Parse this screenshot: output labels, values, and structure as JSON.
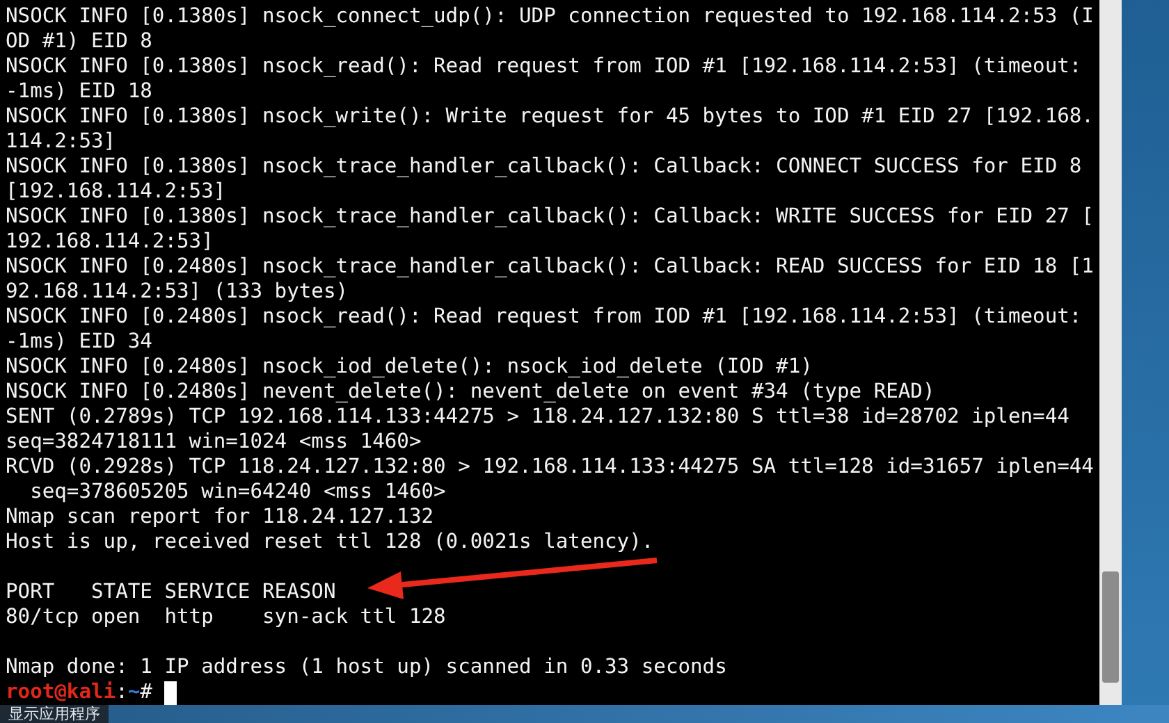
{
  "terminal": {
    "blocks": [
      [
        "NSOCK INFO [0.1380s] nsock_connect_udp(): UDP connection requested to 192.168.114.2:53 (I",
        "OD #1) EID 8",
        "NSOCK INFO [0.1380s] nsock_read(): Read request from IOD #1 [192.168.114.2:53] (timeout:",
        "-1ms) EID 18",
        "NSOCK INFO [0.1380s] nsock_write(): Write request for 45 bytes to IOD #1 EID 27 [192.168.",
        "114.2:53]",
        "NSOCK INFO [0.1380s] nsock_trace_handler_callback(): Callback: CONNECT SUCCESS for EID 8",
        "[192.168.114.2:53]",
        "NSOCK INFO [0.1380s] nsock_trace_handler_callback(): Callback: WRITE SUCCESS for EID 27 [",
        "192.168.114.2:53]",
        "NSOCK INFO [0.2480s] nsock_trace_handler_callback(): Callback: READ SUCCESS for EID 18 [1",
        "92.168.114.2:53] (133 bytes)",
        "NSOCK INFO [0.2480s] nsock_read(): Read request from IOD #1 [192.168.114.2:53] (timeout:",
        "-1ms) EID 34",
        "NSOCK INFO [0.2480s] nsock_iod_delete(): nsock_iod_delete (IOD #1)",
        "NSOCK INFO [0.2480s] nevent_delete(): nevent_delete on event #34 (type READ)",
        "SENT (0.2789s) TCP 192.168.114.133:44275 > 118.24.127.132:80 S ttl=38 id=28702 iplen=44",
        "seq=3824718111 win=1024 <mss 1460>",
        "RCVD (0.2928s) TCP 118.24.127.132:80 > 192.168.114.133:44275 SA ttl=128 id=31657 iplen=44",
        "  seq=378605205 win=64240 <mss 1460>",
        "Nmap scan report for 118.24.127.132",
        "Host is up, received reset ttl 128 (0.0021s latency)."
      ],
      [
        "PORT   STATE SERVICE REASON",
        "80/tcp open  http    syn-ack ttl 128"
      ],
      [
        "Nmap done: 1 IP address (1 host up) scanned in 0.33 seconds"
      ]
    ],
    "prompt": {
      "user_host": "root@kali",
      "separator": ":",
      "path": "~",
      "symbol": "#"
    }
  },
  "taskbar": {
    "label": "显示应用程序"
  }
}
